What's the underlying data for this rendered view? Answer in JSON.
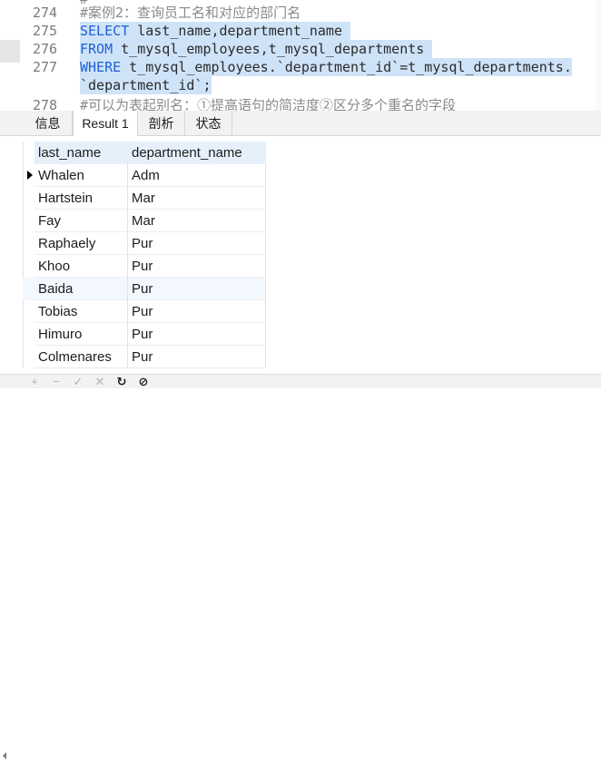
{
  "editor": {
    "cut_top_line": "#",
    "lines": [
      {
        "num": "274",
        "parts": [
          {
            "t": "#案例2：查询员工名和对应的部门名",
            "c": "cmt"
          }
        ]
      },
      {
        "num": "275",
        "parts": [
          {
            "t": "SELECT",
            "c": "kw"
          },
          {
            "t": " last_name,department_name ",
            "c": ""
          }
        ]
      },
      {
        "num": "276",
        "parts": [
          {
            "t": "FROM",
            "c": "kw"
          },
          {
            "t": " t_mysql_employees,t_mysql_departments ",
            "c": ""
          }
        ]
      },
      {
        "num": "277",
        "parts": [
          {
            "t": "WHERE",
            "c": "kw"
          },
          {
            "t": " t_mysql_employees.`department_id`=t_mysql_departments.",
            "c": ""
          }
        ]
      },
      {
        "num": "",
        "parts": [
          {
            "t": "`department_id`;",
            "c": ""
          }
        ]
      },
      {
        "num": "278",
        "parts": [
          {
            "t": "#可以为表起别名：①提高语句的简洁度②区分多个重名的字段",
            "c": "cmt"
          }
        ]
      }
    ]
  },
  "tabs": [
    {
      "label": "信息",
      "active": false
    },
    {
      "label": "Result 1",
      "active": true
    },
    {
      "label": "剖析",
      "active": false
    },
    {
      "label": "状态",
      "active": false
    }
  ],
  "grid": {
    "columns": [
      "last_name",
      "department_name"
    ],
    "rows": [
      [
        "Whalen",
        "Adm"
      ],
      [
        "Hartstein",
        "Mar"
      ],
      [
        "Fay",
        "Mar"
      ],
      [
        "Raphaely",
        "Pur"
      ],
      [
        "Khoo",
        "Pur"
      ],
      [
        "Baida",
        "Pur"
      ],
      [
        "Tobias",
        "Pur"
      ],
      [
        "Himuro",
        "Pur"
      ],
      [
        "Colmenares",
        "Pur"
      ]
    ],
    "current_row": 0,
    "highlight_row": 5,
    "header_bg": "#e5f0fb",
    "highlight_bg": "#f2f8fd"
  },
  "statusbar": {
    "icons": [
      {
        "name": "add-record-icon",
        "glyph": "+",
        "dark": false
      },
      {
        "name": "delete-record-icon",
        "glyph": "−",
        "dark": false
      },
      {
        "name": "apply-changes-icon",
        "glyph": "✓",
        "dark": false
      },
      {
        "name": "discard-changes-icon",
        "glyph": "✕",
        "dark": false
      },
      {
        "name": "refresh-icon",
        "glyph": "↻",
        "dark": true
      },
      {
        "name": "stop-icon",
        "glyph": "⊘",
        "dark": true
      }
    ]
  },
  "colors": {
    "selection": "#cfe3f8",
    "keyword": "#1f5fd6",
    "comment": "#8a8a8a"
  }
}
